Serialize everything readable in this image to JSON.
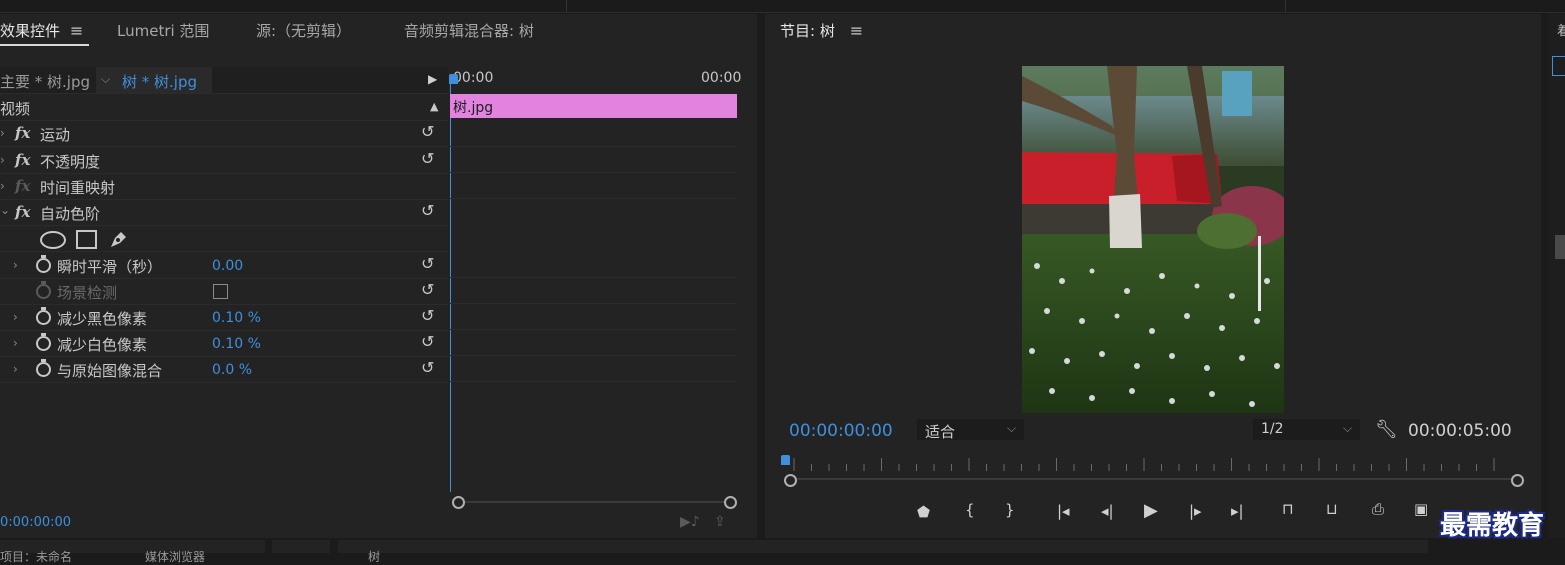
{
  "tabs": [
    {
      "label": "效果控件",
      "active": true
    },
    {
      "label": "Lumetri 范围",
      "active": false
    },
    {
      "label": "源:（无剪辑）",
      "active": false
    },
    {
      "label": "音频剪辑混合器: 树",
      "active": false
    }
  ],
  "program_tab": "节目: 树",
  "source_bar": {
    "master": "主要 * 树.jpg",
    "clip": "树 * 树.jpg",
    "time_start": "00:00",
    "time_end": "00:00"
  },
  "clip_name": "树.jpg",
  "section_video": "视频",
  "effects": [
    {
      "fx": "fx",
      "label": "运动"
    },
    {
      "fx": "fx",
      "label": "不透明度"
    },
    {
      "fx": "fx",
      "label": "时间重映射"
    },
    {
      "fx": "fx",
      "label": "自动色阶"
    }
  ],
  "properties": [
    {
      "label": "瞬时平滑（秒）",
      "value": "0.00"
    },
    {
      "label": "场景检测",
      "value": ""
    },
    {
      "label": "减少黑色像素",
      "value": "0.10 %"
    },
    {
      "label": "减少白色像素",
      "value": "0.10 %"
    },
    {
      "label": "与原始图像混合",
      "value": "0.0 %"
    }
  ],
  "effect_timecode": "0:00:00:00",
  "program": {
    "timecode_current": "00:00:00:00",
    "fit_label": "适合",
    "resolution": "1/2",
    "timecode_total": "00:00:05:00"
  },
  "watermark": "最需教育",
  "bottom_fragments": [
    "项目：未命名",
    "媒体浏览器",
    "树"
  ],
  "colors": {
    "accent": "#3f8fdc",
    "clip_bar": "#e283e0",
    "red_banner": "#c81f2a"
  }
}
